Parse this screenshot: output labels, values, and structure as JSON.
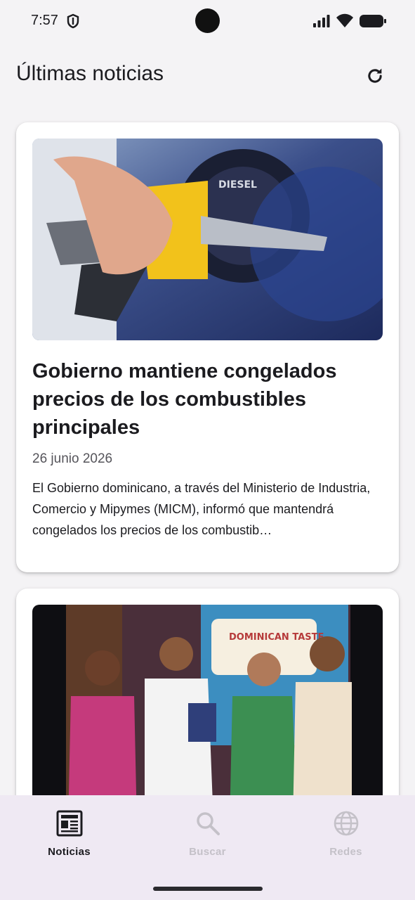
{
  "status": {
    "time": "7:57"
  },
  "app_bar": {
    "title": "Últimas noticias"
  },
  "articles": [
    {
      "title": "Gobierno mantiene congelados precios de los combustibles principales",
      "date": "26 junio 2026",
      "summary": "El Gobierno dominicano, a través del Ministerio de Industria, Comercio y Mipymes (MICM), informó que mantendrá congelados los precios de los combustib…",
      "image_banner_text": "DIESEL"
    },
    {
      "title": "",
      "date": "",
      "summary": "",
      "image_banner_text": "DOMINICAN TASTE"
    }
  ],
  "bottom_nav": {
    "items": [
      {
        "label": "Noticias",
        "icon": "newspaper-icon",
        "active": true
      },
      {
        "label": "Buscar",
        "icon": "search-icon",
        "active": false
      },
      {
        "label": "Redes",
        "icon": "globe-icon",
        "active": false
      }
    ]
  },
  "colors": {
    "background": "#f4f3f5",
    "nav_background": "#efe9f3",
    "active": "#1b1b1f",
    "inactive": "#c4c1c8"
  }
}
